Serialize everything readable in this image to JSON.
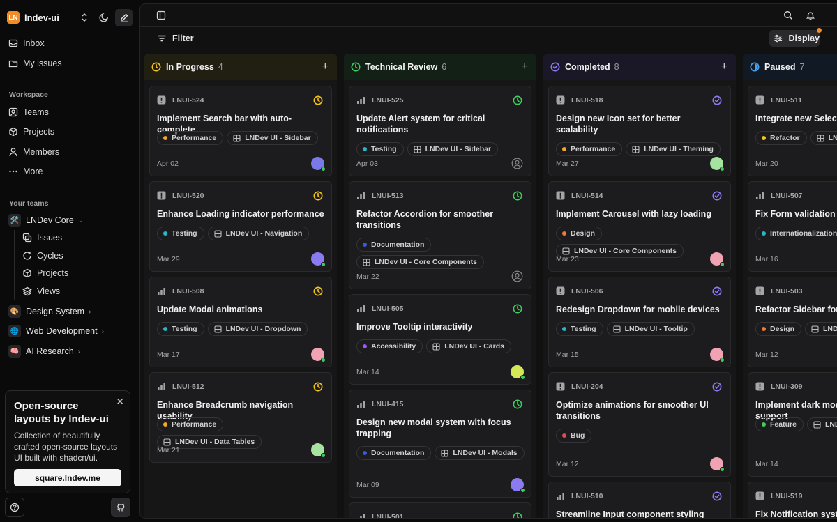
{
  "workspace": {
    "logo": "LN",
    "name": "lndev-ui"
  },
  "sidebar": {
    "nav": [
      {
        "label": "Inbox",
        "icon": "inbox-icon"
      },
      {
        "label": "My issues",
        "icon": "folder-icon"
      }
    ],
    "workspace_label": "Workspace",
    "workspace_items": [
      {
        "label": "Teams",
        "icon": "teams-icon"
      },
      {
        "label": "Projects",
        "icon": "box-icon"
      },
      {
        "label": "Members",
        "icon": "user-icon"
      },
      {
        "label": "More",
        "icon": "more-icon"
      }
    ],
    "teams_label": "Your teams",
    "teams": [
      {
        "label": "LNDev Core",
        "emoji": "🛠️"
      },
      {
        "label": "Design System",
        "emoji": "🎨"
      },
      {
        "label": "Web Development",
        "emoji": "🌐"
      },
      {
        "label": "AI Research",
        "emoji": "🧠"
      }
    ],
    "core_sub": [
      {
        "label": "Issues"
      },
      {
        "label": "Cycles"
      },
      {
        "label": "Projects"
      },
      {
        "label": "Views"
      }
    ],
    "promo": {
      "title": "Open-source layouts by lndev-ui",
      "text": "Collection of beautifully crafted open-source layouts UI built with shadcn/ui.",
      "button": "square.lndev.me"
    }
  },
  "toolbar": {
    "filter": "Filter",
    "display": "Display"
  },
  "colors": {
    "accent": "#f28c28",
    "in_progress": "#f5c518",
    "review": "#3ecf5a",
    "completed": "#8b7cf6",
    "paused": "#4aa3f0"
  },
  "columns": [
    {
      "title": "In Progress",
      "count": "4",
      "status_color": "#f5c518",
      "cards": [
        {
          "id": "LNUI-524",
          "priority": "urgent",
          "title": "Implement Search bar with auto-complete",
          "tags": [
            [
              "Performance",
              "dot",
              "#f5a623"
            ],
            [
              "LNDev UI - Sidebar",
              "proj",
              ""
            ]
          ],
          "date": "Apr 02",
          "avatar": "#7b78e8"
        },
        {
          "id": "LNUI-520",
          "priority": "urgent",
          "title": "Enhance Loading indicator performance",
          "tags": [
            [
              "Testing",
              "dot",
              "#2bb5c8"
            ],
            [
              "LNDev UI - Navigation",
              "proj",
              ""
            ]
          ],
          "date": "Mar 29",
          "avatar": "#8a7cf0"
        },
        {
          "id": "LNUI-508",
          "priority": "high",
          "title": "Update Modal animations",
          "tags": [
            [
              "Testing",
              "dot",
              "#2bb5c8"
            ],
            [
              "LNDev UI - Dropdown",
              "proj",
              ""
            ]
          ],
          "date": "Mar 17",
          "avatar": "#f2a3b3"
        },
        {
          "id": "LNUI-512",
          "priority": "high",
          "title": "Enhance Breadcrumb navigation usability",
          "tags": [
            [
              "Performance",
              "dot",
              "#f5a623"
            ],
            [
              "LNDev UI - Data Tables",
              "proj",
              ""
            ]
          ],
          "date": "Mar 21",
          "avatar": "#a6e3a1"
        }
      ]
    },
    {
      "title": "Technical Review",
      "count": "6",
      "status_color": "#3ecf5a",
      "cards": [
        {
          "id": "LNUI-525",
          "priority": "high",
          "title": "Update Alert system for critical notifications",
          "tags": [
            [
              "Testing",
              "dot",
              "#2bb5c8"
            ],
            [
              "LNDev UI - Sidebar",
              "proj",
              ""
            ]
          ],
          "date": "Apr 03",
          "avatar": ""
        },
        {
          "id": "LNUI-513",
          "priority": "high",
          "title": "Refactor Accordion for smoother transitions",
          "tags": [
            [
              "Documentation",
              "dot",
              "#3b5bdb"
            ],
            [
              "LNDev UI - Core Components",
              "proj",
              ""
            ]
          ],
          "date": "Mar 22",
          "avatar": ""
        },
        {
          "id": "LNUI-505",
          "priority": "high",
          "title": "Improve Tooltip interactivity",
          "tags": [
            [
              "Accessibility",
              "dot",
              "#9b59f5"
            ],
            [
              "LNDev UI - Cards",
              "proj",
              ""
            ]
          ],
          "date": "Mar 14",
          "avatar": "#d4e857"
        },
        {
          "id": "LNUI-415",
          "priority": "high",
          "title": "Design new modal system with focus trapping",
          "tags": [
            [
              "Documentation",
              "dot",
              "#3b5bdb"
            ],
            [
              "LNDev UI - Modals",
              "proj",
              ""
            ]
          ],
          "date": "Mar 09",
          "avatar": "#8a7cf0"
        },
        {
          "id": "LNUI-501",
          "priority": "high",
          "title": "",
          "tags": [],
          "date": "",
          "avatar": ""
        }
      ]
    },
    {
      "title": "Completed",
      "count": "8",
      "status_color": "#8b7cf6",
      "cards": [
        {
          "id": "LNUI-518",
          "priority": "urgent",
          "title": "Design new Icon set for better scalability",
          "tags": [
            [
              "Performance",
              "dot",
              "#f5a623"
            ],
            [
              "LNDev UI - Theming",
              "proj",
              ""
            ]
          ],
          "date": "Mar 27",
          "avatar": "#a6e3a1"
        },
        {
          "id": "LNUI-514",
          "priority": "urgent",
          "title": "Implement Carousel with lazy loading",
          "tags": [
            [
              "Design",
              "dot",
              "#f07a3a"
            ],
            [
              "LNDev UI - Core Components",
              "proj",
              ""
            ]
          ],
          "date": "Mar 23",
          "avatar": "#f2a3b3"
        },
        {
          "id": "LNUI-506",
          "priority": "urgent",
          "title": "Redesign Dropdown for mobile devices",
          "tags": [
            [
              "Testing",
              "dot",
              "#2bb5c8"
            ],
            [
              "LNDev UI - Tooltip",
              "proj",
              ""
            ]
          ],
          "date": "Mar 15",
          "avatar": "#f2a3b3"
        },
        {
          "id": "LNUI-204",
          "priority": "urgent",
          "title": "Optimize animations for smoother UI transitions",
          "tags": [
            [
              "Bug",
              "dot",
              "#e5484d"
            ]
          ],
          "date": "Mar 12",
          "avatar": "#f2a3b3"
        },
        {
          "id": "LNUI-510",
          "priority": "high",
          "title": "Streamline Input component styling",
          "tags": [],
          "date": "",
          "avatar": ""
        }
      ]
    },
    {
      "title": "Paused",
      "count": "7",
      "status_color": "#4aa3f0",
      "cards": [
        {
          "id": "LNUI-511",
          "priority": "urgent",
          "title": "Integrate new Select c",
          "tags": [
            [
              "Refactor",
              "dot",
              "#f5c518"
            ],
            [
              "LN",
              "proj",
              ""
            ]
          ],
          "date": "Mar 20",
          "avatar": ""
        },
        {
          "id": "LNUI-507",
          "priority": "high",
          "title": "Fix Form validation is",
          "tags": [
            [
              "Internationalization",
              "dot",
              "#2bb5c8"
            ]
          ],
          "date": "Mar 16",
          "avatar": ""
        },
        {
          "id": "LNUI-503",
          "priority": "urgent",
          "title": "Refactor Sidebar for b",
          "tags": [
            [
              "Design",
              "dot",
              "#f07a3a"
            ],
            [
              "LND",
              "proj",
              ""
            ]
          ],
          "date": "Mar 12",
          "avatar": ""
        },
        {
          "id": "LNUI-309",
          "priority": "urgent",
          "title": "Implement dark mode preferences support",
          "tags": [
            [
              "Feature",
              "dot",
              "#3ecf5a"
            ],
            [
              "LND",
              "proj",
              ""
            ]
          ],
          "date": "Mar 14",
          "avatar": ""
        },
        {
          "id": "LNUI-519",
          "priority": "urgent",
          "title": "Fix Notification syste",
          "tags": [],
          "date": "",
          "avatar": ""
        }
      ]
    }
  ]
}
